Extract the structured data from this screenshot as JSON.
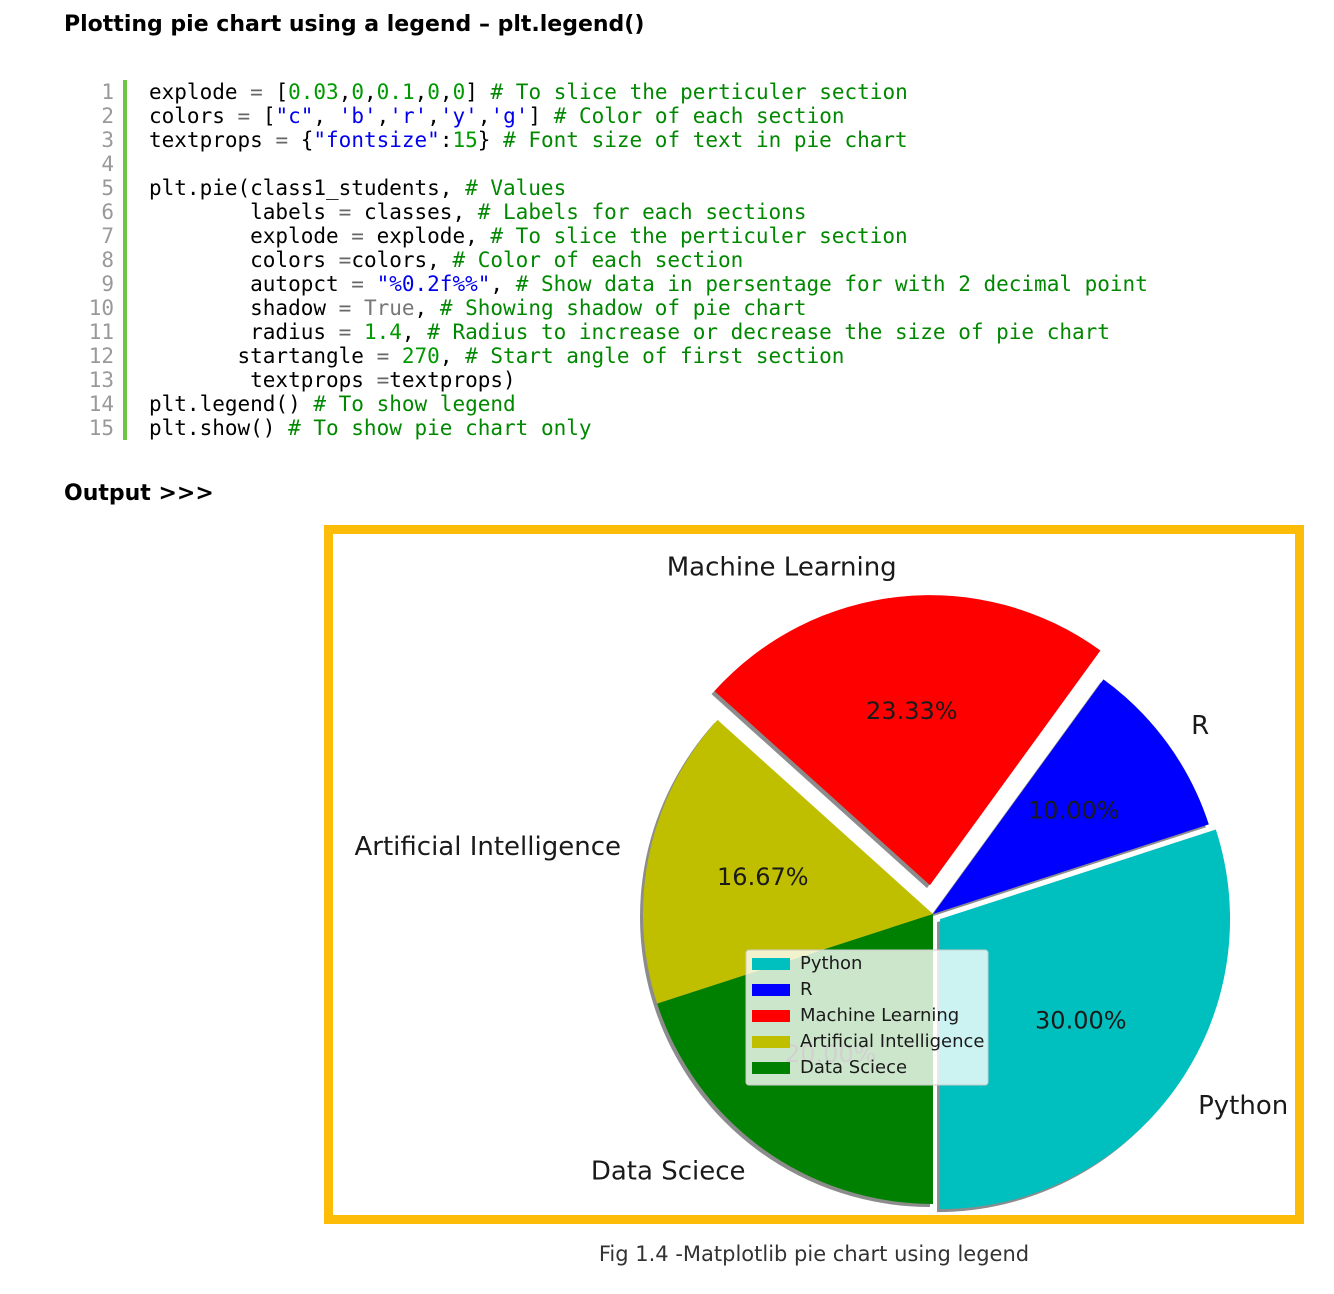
{
  "heading": "Plotting pie chart using a legend – plt.legend()",
  "code_lines": [
    {
      "num": "1",
      "tokens": [
        [
          "p",
          "explode "
        ],
        [
          "o",
          "= "
        ],
        [
          "p",
          "["
        ],
        [
          "n",
          "0.03"
        ],
        [
          "p",
          ","
        ],
        [
          "n",
          "0"
        ],
        [
          "p",
          ","
        ],
        [
          "n",
          "0.1"
        ],
        [
          "p",
          ","
        ],
        [
          "n",
          "0"
        ],
        [
          "p",
          ","
        ],
        [
          "n",
          "0"
        ],
        [
          "p",
          "] "
        ],
        [
          "c",
          "# To slice the perticuler section"
        ]
      ]
    },
    {
      "num": "2",
      "tokens": [
        [
          "p",
          "colors "
        ],
        [
          "o",
          "= "
        ],
        [
          "p",
          "["
        ],
        [
          "s",
          "\"c\""
        ],
        [
          "p",
          ", "
        ],
        [
          "s",
          "'b'"
        ],
        [
          "p",
          ","
        ],
        [
          "s",
          "'r'"
        ],
        [
          "p",
          ","
        ],
        [
          "s",
          "'y'"
        ],
        [
          "p",
          ","
        ],
        [
          "s",
          "'g'"
        ],
        [
          "p",
          "] "
        ],
        [
          "c",
          "# Color of each section"
        ]
      ]
    },
    {
      "num": "3",
      "tokens": [
        [
          "p",
          "textprops "
        ],
        [
          "o",
          "= "
        ],
        [
          "p",
          "{"
        ],
        [
          "s",
          "\"fontsize\""
        ],
        [
          "p",
          ":"
        ],
        [
          "n",
          "15"
        ],
        [
          "p",
          "} "
        ],
        [
          "c",
          "# Font size of text in pie chart"
        ]
      ]
    },
    {
      "num": "4",
      "tokens": []
    },
    {
      "num": "5",
      "tokens": [
        [
          "p",
          "plt.pie(class1_students, "
        ],
        [
          "c",
          "# Values"
        ]
      ]
    },
    {
      "num": "6",
      "tokens": [
        [
          "p",
          "        labels "
        ],
        [
          "o",
          "= "
        ],
        [
          "p",
          "classes, "
        ],
        [
          "c",
          "# Labels for each sections"
        ]
      ]
    },
    {
      "num": "7",
      "tokens": [
        [
          "p",
          "        explode "
        ],
        [
          "o",
          "= "
        ],
        [
          "p",
          "explode, "
        ],
        [
          "c",
          "# To slice the perticuler section"
        ]
      ]
    },
    {
      "num": "8",
      "tokens": [
        [
          "p",
          "        colors "
        ],
        [
          "o",
          "="
        ],
        [
          "p",
          "colors, "
        ],
        [
          "c",
          "# Color of each section"
        ]
      ]
    },
    {
      "num": "9",
      "tokens": [
        [
          "p",
          "        autopct "
        ],
        [
          "o",
          "= "
        ],
        [
          "s",
          "\"%0.2f%%\""
        ],
        [
          "p",
          ", "
        ],
        [
          "c",
          "# Show data in persentage for with 2 decimal point"
        ]
      ]
    },
    {
      "num": "10",
      "tokens": [
        [
          "p",
          "        shadow "
        ],
        [
          "o",
          "= "
        ],
        [
          "k",
          "True"
        ],
        [
          "p",
          ", "
        ],
        [
          "c",
          "# Showing shadow of pie chart"
        ]
      ]
    },
    {
      "num": "11",
      "tokens": [
        [
          "p",
          "        radius "
        ],
        [
          "o",
          "= "
        ],
        [
          "n",
          "1.4"
        ],
        [
          "p",
          ", "
        ],
        [
          "c",
          "# Radius to increase or decrease the size of pie chart"
        ]
      ]
    },
    {
      "num": "12",
      "tokens": [
        [
          "p",
          "       startangle "
        ],
        [
          "o",
          "= "
        ],
        [
          "n",
          "270"
        ],
        [
          "p",
          ", "
        ],
        [
          "c",
          "# Start angle of first section"
        ]
      ]
    },
    {
      "num": "13",
      "tokens": [
        [
          "p",
          "        textprops "
        ],
        [
          "o",
          "="
        ],
        [
          "p",
          "textprops)"
        ]
      ]
    },
    {
      "num": "14",
      "tokens": [
        [
          "p",
          "plt.legend() "
        ],
        [
          "c",
          "# To show legend"
        ]
      ]
    },
    {
      "num": "15",
      "tokens": [
        [
          "p",
          "plt.show() "
        ],
        [
          "c",
          "# To show pie chart only"
        ]
      ]
    }
  ],
  "output_label": "Output >>>",
  "caption": "Fig 1.4 -Matplotlib pie chart using legend",
  "colors": {
    "frame": "#fdbc08",
    "line_gutter": "#6cc644"
  },
  "chart_data": {
    "type": "pie",
    "title": "",
    "startangle": 270,
    "counterclock": true,
    "shadow": true,
    "legend_placement": "center",
    "slices": [
      {
        "label": "Python",
        "value": 30.0,
        "pct_label": "30.00%",
        "color": "#00bfbf",
        "explode": 0.03
      },
      {
        "label": "R",
        "value": 10.0,
        "pct_label": "10.00%",
        "color": "#0000ff",
        "explode": 0
      },
      {
        "label": "Machine Learning",
        "value": 23.33,
        "pct_label": "23.33%",
        "color": "#ff0000",
        "explode": 0.1
      },
      {
        "label": "Artificial Intelligence",
        "value": 16.67,
        "pct_label": "16.67%",
        "color": "#bfbf00",
        "explode": 0
      },
      {
        "label": "Data Sciece",
        "value": 20.0,
        "pct_label": "20.00%",
        "color": "#008000",
        "explode": 0
      }
    ],
    "legend": [
      "Python",
      "R",
      "Machine Learning",
      "Artificial Intelligence",
      "Data Sciece"
    ]
  }
}
